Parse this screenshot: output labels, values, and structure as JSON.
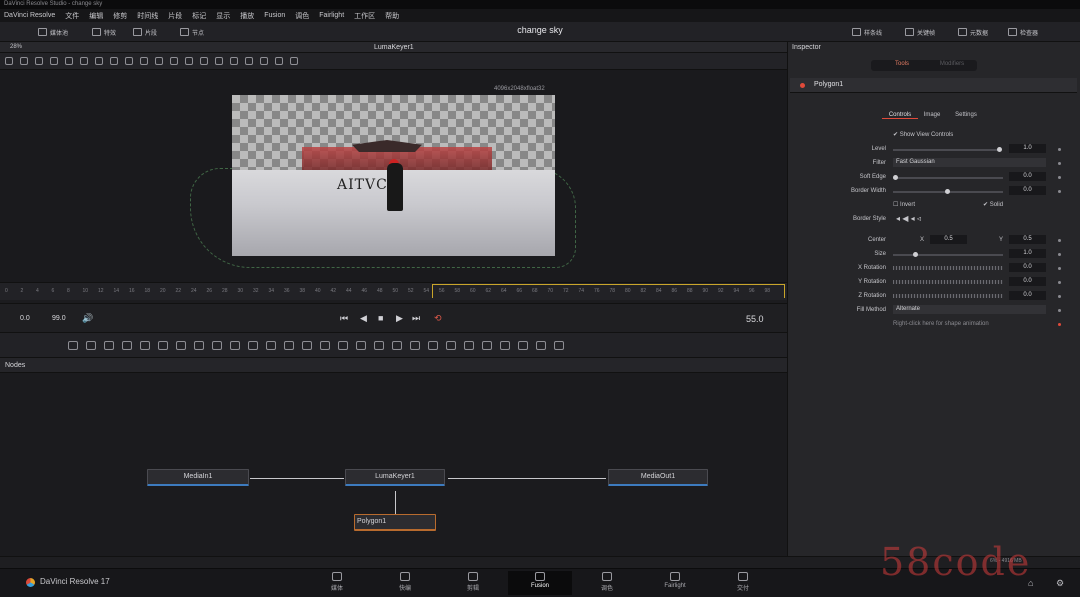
{
  "window_title": "DaVinci Resolve Studio - change sky",
  "menu": [
    "DaVinci Resolve",
    "文件",
    "编辑",
    "修剪",
    "时间线",
    "片段",
    "标记",
    "显示",
    "播放",
    "Fusion",
    "调色",
    "Fairlight",
    "工作区",
    "帮助"
  ],
  "toolbar": {
    "left": [
      {
        "icon": "media-pool-icon",
        "label": "媒体池"
      },
      {
        "icon": "effects-icon",
        "label": "特效"
      },
      {
        "icon": "clips-icon",
        "label": "片段"
      },
      {
        "icon": "nodes-icon",
        "label": "节点"
      }
    ],
    "project_title": "change sky",
    "right": [
      {
        "icon": "spline-icon",
        "label": "样条线"
      },
      {
        "icon": "keyframes-icon",
        "label": "关键帧"
      },
      {
        "icon": "metadata-icon",
        "label": "元数据"
      },
      {
        "icon": "inspector-icon",
        "label": "检查器"
      }
    ]
  },
  "viewer": {
    "zoom": "28%",
    "title": "LumaKeyer1",
    "resolution": "4096x2048xfloat32",
    "image_text": "AITVC"
  },
  "ruler_ticks": [
    "0",
    "2",
    "4",
    "6",
    "8",
    "10",
    "12",
    "14",
    "16",
    "18",
    "20",
    "22",
    "24",
    "26",
    "28",
    "30",
    "32",
    "34",
    "36",
    "38",
    "40",
    "42",
    "44",
    "46",
    "48",
    "50",
    "52",
    "54",
    "56",
    "58",
    "60",
    "62",
    "64",
    "66",
    "68",
    "70",
    "72",
    "74",
    "76",
    "78",
    "80",
    "82",
    "84",
    "86",
    "88",
    "90",
    "92",
    "94",
    "96",
    "98"
  ],
  "transport": {
    "start": "0.0",
    "end": "99.0",
    "current": "55.0"
  },
  "nodes_panel": {
    "title": "Nodes",
    "nodes": [
      "MediaIn1",
      "LumaKeyer1",
      "MediaOut1",
      "Polygon1"
    ]
  },
  "inspector": {
    "title": "Inspector",
    "tab_tools": "Tools",
    "tab_modifiers": "Modifiers",
    "node_name": "Polygon1",
    "subtabs": [
      "Controls",
      "Image",
      "Settings"
    ],
    "show_view_controls": "Show View Controls",
    "level": {
      "label": "Level",
      "value": "1.0"
    },
    "filter": {
      "label": "Filter",
      "value": "Fast Gaussian"
    },
    "soft_edge": {
      "label": "Soft Edge",
      "value": "0.0"
    },
    "border_width": {
      "label": "Border Width",
      "value": "0.0"
    },
    "invert": "Invert",
    "solid": "Solid",
    "border_style": "Border Style",
    "center": {
      "label": "Center",
      "x_label": "X",
      "x": "0.5",
      "y_label": "Y",
      "y": "0.5"
    },
    "size": {
      "label": "Size",
      "value": "1.0"
    },
    "x_rotation": {
      "label": "X Rotation",
      "value": "0.0"
    },
    "y_rotation": {
      "label": "Y Rotation",
      "value": "0.0"
    },
    "z_rotation": {
      "label": "Z Rotation",
      "value": "0.0"
    },
    "fill_method": {
      "label": "Fill Method",
      "value": "Alternate"
    },
    "hint": "Right-click here for shape animation"
  },
  "status": "6% - 4916 MB",
  "pages": [
    {
      "icon": "media-icon",
      "label": "媒体"
    },
    {
      "icon": "cut-icon",
      "label": "快编"
    },
    {
      "icon": "edit-icon",
      "label": "剪辑"
    },
    {
      "icon": "fusion-icon",
      "label": "Fusion"
    },
    {
      "icon": "color-icon",
      "label": "调色"
    },
    {
      "icon": "fairlight-icon",
      "label": "Fairlight"
    },
    {
      "icon": "deliver-icon",
      "label": "交付"
    }
  ],
  "app_label": "DaVinci Resolve 17",
  "watermark": "58code"
}
